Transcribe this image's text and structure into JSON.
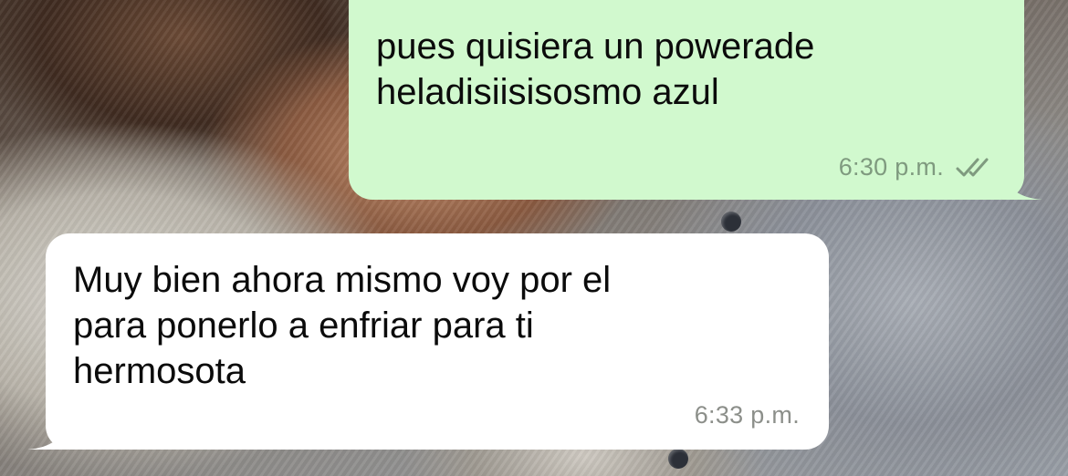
{
  "colors": {
    "outgoing_bubble": "#d1f9ce",
    "incoming_bubble": "#ffffff",
    "timestamp_text": "#8c8f8a"
  },
  "messages": [
    {
      "direction": "outgoing",
      "text": "pues quisiera un powerade\nheladisiisisosmo azul",
      "time": "6:30 p.m.",
      "status_icon": "double-check-icon"
    },
    {
      "direction": "incoming",
      "text": "Muy bien ahora mismo voy por el\npara ponerlo a enfriar para ti\nhermosota",
      "time": "6:33 p.m."
    }
  ]
}
